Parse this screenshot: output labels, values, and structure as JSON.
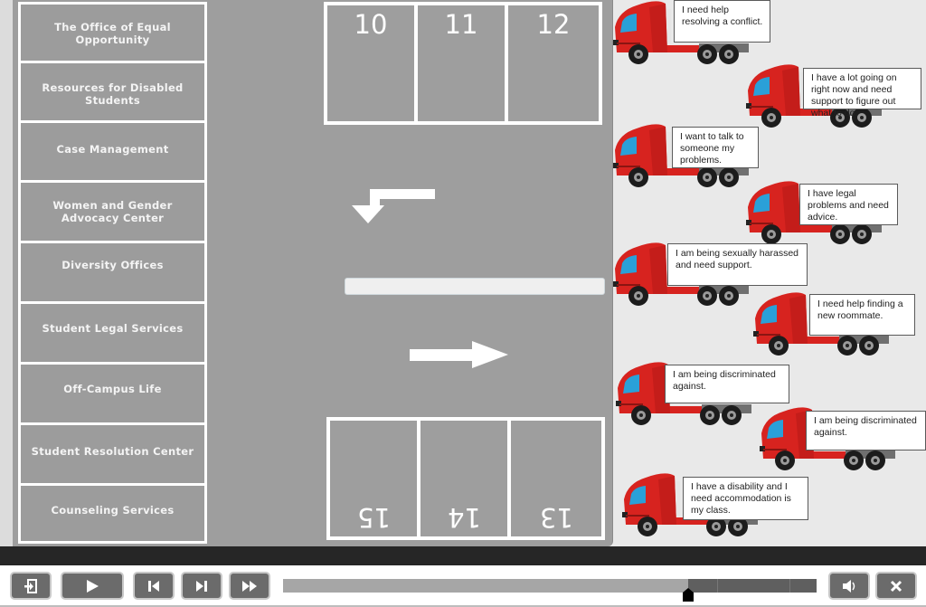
{
  "destinations": [
    {
      "label": "The Office of Equal Opportunity"
    },
    {
      "label": "Resources for Disabled Students"
    },
    {
      "label": "Case Management"
    },
    {
      "label": "Women and Gender Advocacy Center"
    },
    {
      "label": "Diversity Offices"
    },
    {
      "label": "Student Legal Services"
    },
    {
      "label": "Off-Campus Life"
    },
    {
      "label": "Student Resolution Center"
    },
    {
      "label": "Counseling Services"
    }
  ],
  "parking": {
    "top_spots": [
      "10",
      "11",
      "12"
    ],
    "bottom_spots": [
      "15",
      "14",
      "13"
    ]
  },
  "trucks": [
    {
      "text": "I need help resolving a conflict."
    },
    {
      "text": "I have a lot going on right now and need support to figure out what to do."
    },
    {
      "text": "I want to talk to someone my problems."
    },
    {
      "text": "I have legal problems and need advice."
    },
    {
      "text": "I am being sexually harassed and need support."
    },
    {
      "text": "I need help finding a new roommate."
    },
    {
      "text": "I am being discriminated against."
    },
    {
      "text": "I am being discriminated against."
    },
    {
      "text": "I have a disability and I need accommodation is my class."
    }
  ],
  "player": {
    "buttons": [
      {
        "name": "exit",
        "icon": "exit-icon"
      },
      {
        "name": "play",
        "icon": "play-icon"
      },
      {
        "name": "previous",
        "icon": "skip-back-icon"
      },
      {
        "name": "next",
        "icon": "skip-forward-icon"
      },
      {
        "name": "fast-forward",
        "icon": "fast-forward-icon"
      },
      {
        "name": "volume",
        "icon": "speaker-icon"
      },
      {
        "name": "close",
        "icon": "close-icon"
      }
    ],
    "progress_fraction": 0.76
  },
  "colors": {
    "truck_red": "#d7231f",
    "windshield": "#2aa0d8",
    "lot_gray": "#9e9e9e",
    "control_gray": "#6b6b6b"
  }
}
